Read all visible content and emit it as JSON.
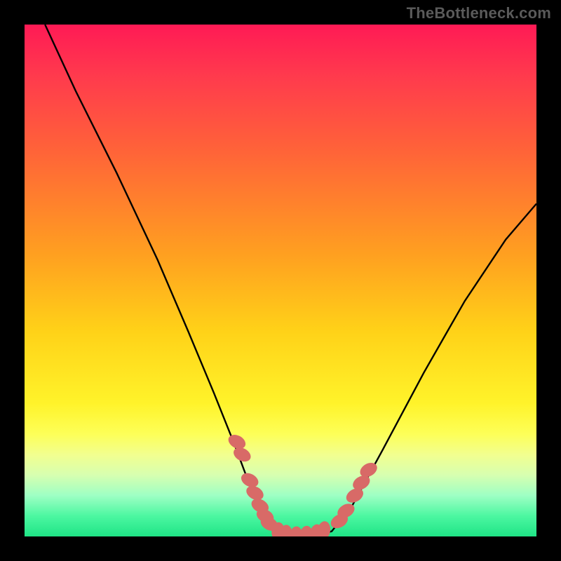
{
  "watermark": "TheBottleneck.com",
  "chart_data": {
    "type": "line",
    "title": "",
    "xlabel": "",
    "ylabel": "",
    "xlim": [
      0,
      100
    ],
    "ylim": [
      0,
      100
    ],
    "grid": false,
    "series": [
      {
        "name": "curve-left",
        "x": [
          4,
          10,
          18,
          26,
          32,
          37,
          41,
          44,
          47,
          49
        ],
        "y": [
          100,
          87,
          71,
          54,
          40,
          28,
          18,
          10,
          4,
          1
        ]
      },
      {
        "name": "floor",
        "x": [
          49,
          52,
          56,
          60
        ],
        "y": [
          1,
          0,
          0,
          1
        ]
      },
      {
        "name": "curve-right",
        "x": [
          60,
          64,
          70,
          78,
          86,
          94,
          100
        ],
        "y": [
          1,
          6,
          17,
          32,
          46,
          58,
          65
        ]
      },
      {
        "name": "dots-left",
        "x": [
          41.5,
          42.5,
          44.0,
          45.0,
          46.0,
          47.0,
          47.8
        ],
        "y": [
          18.5,
          16,
          11,
          8.5,
          6,
          4,
          2.5
        ]
      },
      {
        "name": "dots-bottom",
        "x": [
          49.5,
          51,
          53,
          55,
          57,
          58.5
        ],
        "y": [
          1,
          0.5,
          0.2,
          0.3,
          0.6,
          1.2
        ]
      },
      {
        "name": "dots-right",
        "x": [
          61.5,
          62.8,
          64.5,
          65.8,
          67.2
        ],
        "y": [
          3,
          5,
          8,
          10.5,
          13
        ]
      }
    ]
  },
  "colors": {
    "curve": "#000000",
    "dot": "#d86a67",
    "background_top": "#ff1a55",
    "background_bottom": "#1fe486",
    "frame": "#000000",
    "watermark": "#5a5a5a"
  }
}
